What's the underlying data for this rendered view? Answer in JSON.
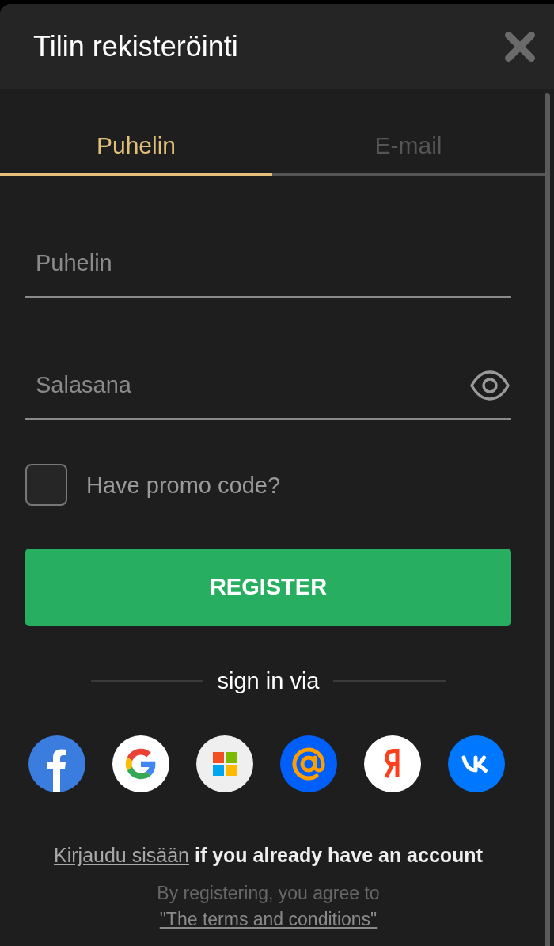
{
  "dialog": {
    "title": "Tilin rekisteröinti"
  },
  "tabs": [
    {
      "label": "Puhelin",
      "selected": true
    },
    {
      "label": "E-mail",
      "selected": false
    }
  ],
  "fields": [
    {
      "kind": "text",
      "placeholder": "Puhelin"
    },
    {
      "kind": "password",
      "placeholder": "Salasana"
    }
  ],
  "promo": {
    "label": "Have promo code?",
    "checked": false
  },
  "register_button": {
    "label": "REGISTER"
  },
  "social_login": {
    "heading": "sign in via"
  },
  "login_prompt": {
    "link": "Kirjaudu sisään",
    "text": "if you already have an account"
  },
  "terms": {
    "text": "By registering, you agree to",
    "link": "\"The terms and conditions\""
  }
}
